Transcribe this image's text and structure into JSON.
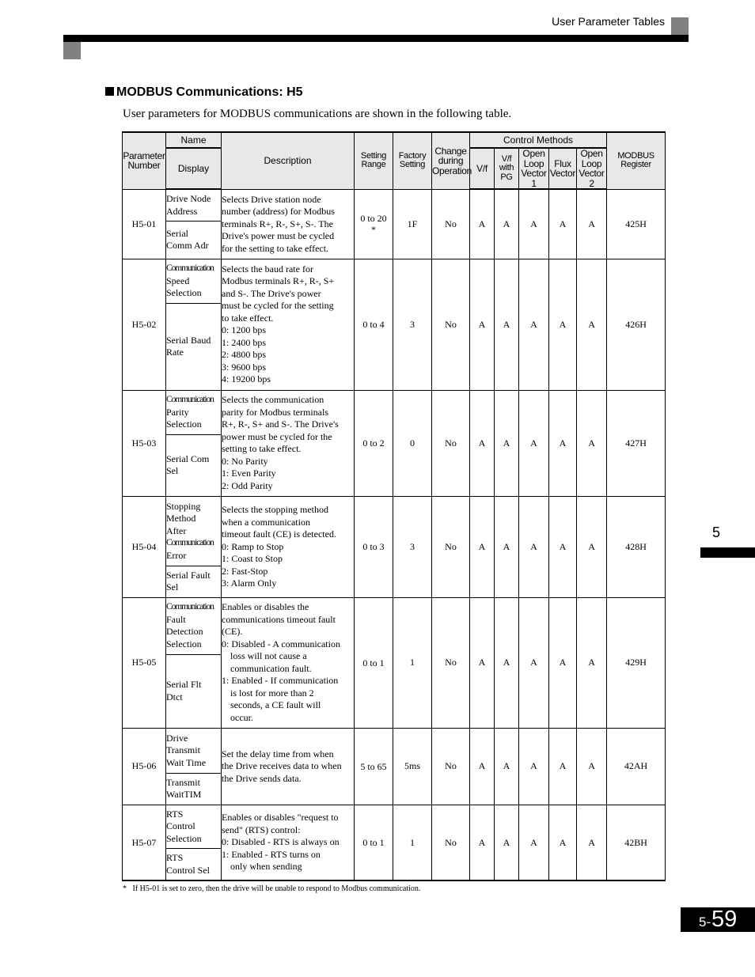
{
  "header": {
    "section_label": "User Parameter Tables"
  },
  "section": {
    "title": "MODBUS Communications: H5",
    "bullet_icon": "black-square",
    "intro": "User parameters for MODBUS communications are shown in the following table."
  },
  "table": {
    "headers": {
      "param_number": "Parameter Number",
      "name": "Name",
      "display": "Display",
      "description": "Description",
      "setting_range": "Setting Range",
      "factory_setting": "Factory Setting",
      "change_during_operation": "Change during Operation",
      "control_methods": "Control Methods",
      "vf": "V/f",
      "vf_pg": "V/f with PG",
      "olv1": "Open Loop Vector 1",
      "flux": "Flux Vector",
      "olv2": "Open Loop Vector 2",
      "modbus_register": "MODBUS Register"
    },
    "rows": [
      {
        "number": "H5-01",
        "name": [
          "Drive Node",
          "Address"
        ],
        "display": [
          "Serial",
          "Comm Adr"
        ],
        "description": [
          "Selects Drive station node",
          "number (address) for Modbus",
          "terminals R+, R-, S+, S-. The",
          "Drive's power must be cycled",
          "for the setting to take effect."
        ],
        "range": [
          "0 to 20",
          "*"
        ],
        "factory": "1F",
        "change": "No",
        "methods": [
          "A",
          "A",
          "A",
          "A",
          "A"
        ],
        "register": "425H"
      },
      {
        "number": "H5-02",
        "name": [
          "Communication",
          "Speed",
          "Selection"
        ],
        "display": [
          "Serial Baud",
          "Rate"
        ],
        "description": [
          "Selects the baud rate for",
          "Modbus terminals R+, R-, S+",
          "and S-. The Drive's power",
          "must be cycled for the setting",
          "to take effect.",
          "0: 1200 bps",
          "1: 2400 bps",
          "2: 4800 bps",
          "3: 9600 bps",
          "4: 19200 bps"
        ],
        "range": [
          "0 to 4"
        ],
        "factory": "3",
        "change": "No",
        "methods": [
          "A",
          "A",
          "A",
          "A",
          "A"
        ],
        "register": "426H"
      },
      {
        "number": "H5-03",
        "name": [
          "Communication",
          "Parity",
          "Selection"
        ],
        "display": [
          "Serial Com",
          "Sel"
        ],
        "description": [
          "Selects the communication",
          "parity for Modbus terminals",
          "R+, R-, S+ and S-. The Drive's",
          "power must be cycled for the",
          "setting to take effect.",
          "0: No Parity",
          "1: Even Parity",
          "2: Odd Parity"
        ],
        "range": [
          "0 to 2"
        ],
        "factory": "0",
        "change": "No",
        "methods": [
          "A",
          "A",
          "A",
          "A",
          "A"
        ],
        "register": "427H"
      },
      {
        "number": "H5-04",
        "name": [
          "Stopping",
          "Method",
          "After",
          "Communication",
          "Error"
        ],
        "display": [
          "Serial Fault",
          "Sel"
        ],
        "description": [
          "Selects the stopping method",
          "when a communication",
          "timeout fault (CE) is detected.",
          "0: Ramp to Stop",
          "1: Coast to Stop",
          "2: Fast-Stop",
          "3: Alarm Only"
        ],
        "range": [
          "0 to 3"
        ],
        "factory": "3",
        "change": "No",
        "methods": [
          "A",
          "A",
          "A",
          "A",
          "A"
        ],
        "register": "428H"
      },
      {
        "number": "H5-05",
        "name": [
          "Communication",
          "Fault",
          "Detection",
          "Selection"
        ],
        "display": [
          "Serial Flt",
          "Dtct"
        ],
        "description": [
          "Enables or disables the",
          "communications timeout fault",
          "(CE).",
          "0: Disabled - A communication",
          "  loss will not cause a",
          "  communication fault.",
          "1: Enabled - If communication",
          "  is lost for more than 2",
          "  seconds, a CE fault will",
          "  occur."
        ],
        "range": [
          "0 to 1"
        ],
        "factory": "1",
        "change": "No",
        "methods": [
          "A",
          "A",
          "A",
          "A",
          "A"
        ],
        "register": "429H"
      },
      {
        "number": "H5-06",
        "name": [
          "Drive",
          "Transmit",
          "Wait Time"
        ],
        "display": [
          "Transmit",
          "WaitTIM"
        ],
        "description": [
          "Set the delay time from when",
          "the Drive receives data to when",
          "the Drive sends data."
        ],
        "range": [
          "5 to 65"
        ],
        "factory": "5ms",
        "change": "No",
        "methods": [
          "A",
          "A",
          "A",
          "A",
          "A"
        ],
        "register": "42AH"
      },
      {
        "number": "H5-07",
        "name": [
          "RTS",
          "Control",
          "Selection"
        ],
        "display": [
          "RTS",
          "Control Sel"
        ],
        "description": [
          "Enables or disables \"request to",
          "send\" (RTS) control:",
          "0: Disabled - RTS is always on",
          "1: Enabled  - RTS turns on",
          "  only when sending"
        ],
        "range": [
          "0 to 1"
        ],
        "factory": "1",
        "change": "No",
        "methods": [
          "A",
          "A",
          "A",
          "A",
          "A"
        ],
        "register": "42BH"
      }
    ],
    "footnote": "*   If H5-01 is set to zero, then the drive will be unable to respond to Modbus communication."
  },
  "side_tab": {
    "chapter": "5"
  },
  "page_number": {
    "prefix": "5-",
    "number": "59"
  }
}
